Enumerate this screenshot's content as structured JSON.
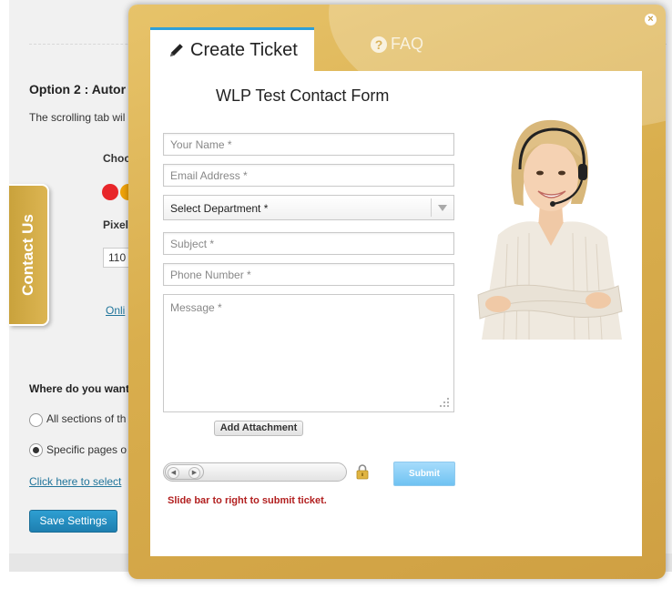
{
  "background_page": {
    "section_heading": "Option 2 : Autor",
    "description": "The scrolling tab wil",
    "choose_label": "Choo",
    "pixel_label": "Pixel",
    "pixel_value": "110",
    "online_link": "Onli",
    "where_heading": "Where do you want",
    "radio_all_label": "All sections of th",
    "radio_specific_label": "Specific pages o",
    "click_here_link": "Click here to select",
    "save_button": "Save Settings",
    "colors": {
      "swatch_red": "#e8262a",
      "swatch_orange": "#f0a30a",
      "link": "#21759b",
      "save_button": "#2e9fd2"
    }
  },
  "side_tab": {
    "label": "Contact Us",
    "color": "#d4ad4a"
  },
  "modal": {
    "close_glyph": "×",
    "tabs": [
      {
        "label": "Create Ticket",
        "icon": "pencil-icon",
        "active": true
      },
      {
        "label": "FAQ",
        "icon": "question-icon",
        "icon_glyph": "?",
        "active": false
      }
    ],
    "form": {
      "title": "WLP Test Contact Form",
      "name_placeholder": "Your Name *",
      "email_placeholder": "Email Address *",
      "department_selected": "Select Department *",
      "subject_placeholder": "Subject *",
      "phone_placeholder": "Phone Number *",
      "message_placeholder": "Message *",
      "attachment_button": "Add Attachment",
      "slider_left_glyph": "◀",
      "slider_right_glyph": "▶",
      "submit_button": "Submit",
      "slide_hint": "Slide bar to right to submit ticket."
    },
    "colors": {
      "accent": "#2e9fd8",
      "gold": "#d9ae4d",
      "hint": "#b21f1f",
      "submit": "#7fcaf4"
    }
  }
}
